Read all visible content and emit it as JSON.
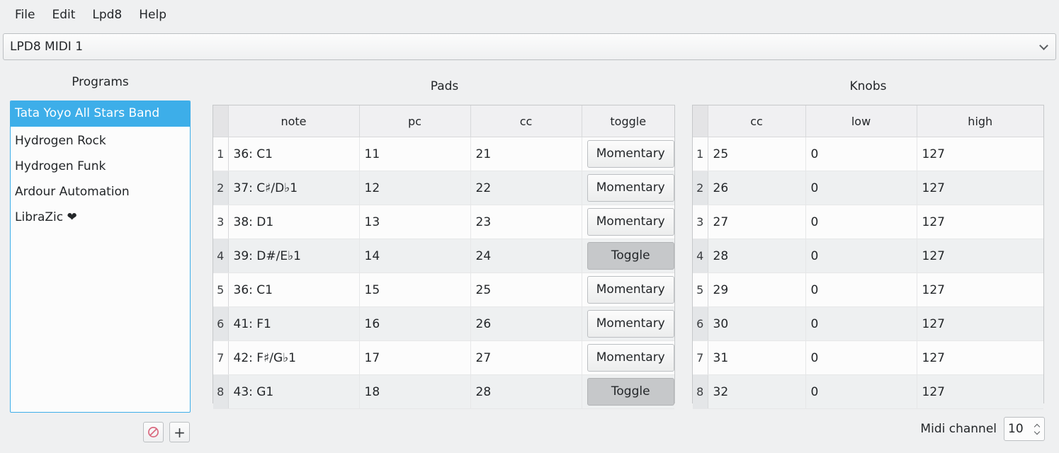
{
  "menubar": {
    "items": [
      {
        "label": "File"
      },
      {
        "label": "Edit"
      },
      {
        "label": "Lpd8"
      },
      {
        "label": "Help"
      }
    ]
  },
  "device_combo": {
    "value": "LPD8 MIDI 1",
    "arrow_icon": "chevron-down-icon"
  },
  "programs": {
    "title": "Programs",
    "items": [
      {
        "label": "Tata Yoyo All Stars Band",
        "selected": true
      },
      {
        "label": "Hydrogen Rock",
        "selected": false
      },
      {
        "label": "Hydrogen Funk",
        "selected": false
      },
      {
        "label": "Ardour Automation",
        "selected": false
      },
      {
        "label": "LibraZic ❤",
        "selected": false
      }
    ],
    "buttons": [
      {
        "name": "delete-program-button",
        "icon": "forbidden-icon",
        "label": "⊘"
      },
      {
        "name": "add-program-button",
        "icon": "plus-icon",
        "label": "+"
      }
    ],
    "selection_color": "#3daee9"
  },
  "pads": {
    "title": "Pads",
    "columns": [
      "",
      "note",
      "pc",
      "cc",
      "toggle"
    ],
    "rows": [
      {
        "index": "1",
        "note": "36: C1",
        "pc": "11",
        "cc": "21",
        "toggle": "Momentary",
        "toggle_state": "momentary"
      },
      {
        "index": "2",
        "note": "37: C♯/D♭1",
        "pc": "12",
        "cc": "22",
        "toggle": "Momentary",
        "toggle_state": "momentary"
      },
      {
        "index": "3",
        "note": "38: D1",
        "pc": "13",
        "cc": "23",
        "toggle": "Momentary",
        "toggle_state": "momentary"
      },
      {
        "index": "4",
        "note": "39: D#/E♭1",
        "pc": "14",
        "cc": "24",
        "toggle": "Toggle",
        "toggle_state": "toggle"
      },
      {
        "index": "5",
        "note": "36: C1",
        "pc": "15",
        "cc": "25",
        "toggle": "Momentary",
        "toggle_state": "momentary"
      },
      {
        "index": "6",
        "note": "41: F1",
        "pc": "16",
        "cc": "26",
        "toggle": "Momentary",
        "toggle_state": "momentary"
      },
      {
        "index": "7",
        "note": "42: F♯/G♭1",
        "pc": "17",
        "cc": "27",
        "toggle": "Momentary",
        "toggle_state": "momentary"
      },
      {
        "index": "8",
        "note": "43: G1",
        "pc": "18",
        "cc": "28",
        "toggle": "Toggle",
        "toggle_state": "toggle"
      }
    ]
  },
  "knobs": {
    "title": "Knobs",
    "columns": [
      "",
      "cc",
      "low",
      "high"
    ],
    "rows": [
      {
        "index": "1",
        "cc": "25",
        "low": "0",
        "high": "127"
      },
      {
        "index": "2",
        "cc": "26",
        "low": "0",
        "high": "127"
      },
      {
        "index": "3",
        "cc": "27",
        "low": "0",
        "high": "127"
      },
      {
        "index": "4",
        "cc": "28",
        "low": "0",
        "high": "127"
      },
      {
        "index": "5",
        "cc": "29",
        "low": "0",
        "high": "127"
      },
      {
        "index": "6",
        "cc": "30",
        "low": "0",
        "high": "127"
      },
      {
        "index": "7",
        "cc": "31",
        "low": "0",
        "high": "127"
      },
      {
        "index": "8",
        "cc": "32",
        "low": "0",
        "high": "127"
      }
    ]
  },
  "midi_channel": {
    "label": "Midi channel",
    "value": "10"
  }
}
